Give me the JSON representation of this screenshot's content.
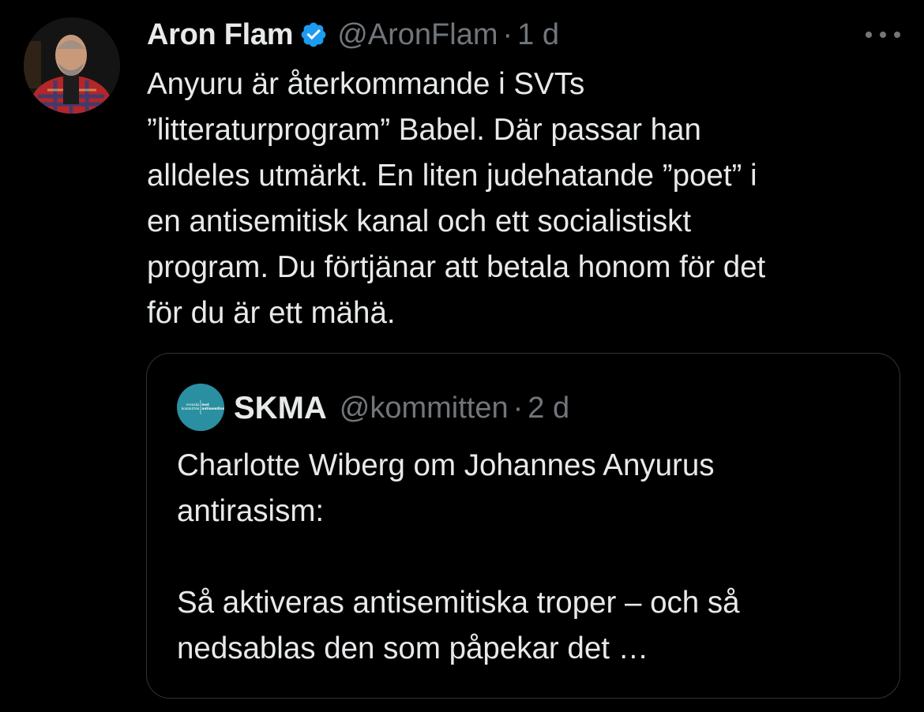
{
  "tweet": {
    "display_name": "Aron Flam",
    "handle": "@AronFlam",
    "separator": "·",
    "time": "1 d",
    "text_lines": [
      "Anyuru är återkommande i SVTs",
      "”litteraturprogram” Babel. Där passar han",
      "alldeles utmärkt. En liten judehatande ”poet” i",
      "en antisemitisk kanal och ett socialistiskt",
      "program. Du förtjänar att betala honom för det",
      "för du är ett mähä."
    ],
    "verified_icon": "verified-badge-icon",
    "more_icon": "more-options-icon"
  },
  "quote": {
    "display_name": "SKMA",
    "handle": "@kommitten",
    "separator": "·",
    "time": "2 d",
    "text_lines": [
      "Charlotte Wiberg om Johannes Anyurus",
      "antirasism:",
      "",
      "Så aktiveras antisemitiska troper – och så",
      "nedsablas den som påpekar det …"
    ],
    "avatar_logo_text": [
      "svenska",
      "kommittén",
      "mot",
      "antisemitism"
    ]
  },
  "colors": {
    "background": "#000000",
    "primary_text": "#e7e9ea",
    "secondary_text": "#71767b",
    "verified_blue": "#1d9bf0",
    "border": "#2f3336",
    "skma_teal": "#2a8fa0"
  }
}
